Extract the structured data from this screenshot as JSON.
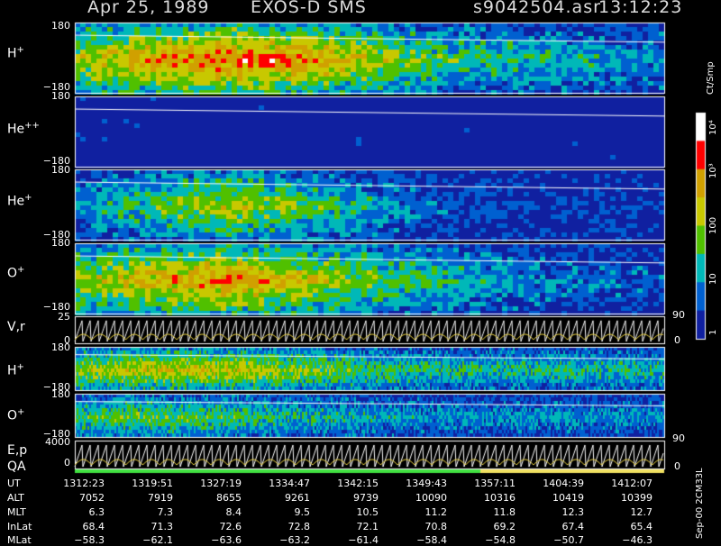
{
  "header": {
    "date": "Apr 25, 1989",
    "instrument": "EXOS-D SMS",
    "file": "s9042504.asr",
    "time": "13:12:23"
  },
  "panels": [
    {
      "label": "H",
      "sup": "+",
      "top_tick": "180",
      "bottom_tick": "−180"
    },
    {
      "label": "He",
      "sup": "++",
      "top_tick": "180",
      "bottom_tick": "−180"
    },
    {
      "label": "He",
      "sup": "+",
      "top_tick": "180",
      "bottom_tick": "−180"
    },
    {
      "label": "O",
      "sup": "+",
      "top_tick": "180",
      "bottom_tick": "−180"
    },
    {
      "label": "V,r",
      "sup": "",
      "top_tick": "25",
      "bottom_tick": "0",
      "right_top": "90",
      "right_bottom": "0"
    },
    {
      "label": "H",
      "sup": "+",
      "top_tick": "180",
      "bottom_tick": "−180"
    },
    {
      "label": "O",
      "sup": "+",
      "top_tick": "180",
      "bottom_tick": "−180"
    },
    {
      "label": "E,p",
      "sup": "",
      "top_tick": "4000",
      "bottom_tick": "0",
      "right_top": "90",
      "right_bottom": "0"
    }
  ],
  "qa_label": "QA",
  "colorbar": {
    "unit": "Ct/Smp",
    "labels": [
      "10⁴",
      "10³",
      "100",
      "10",
      "1"
    ],
    "colors": [
      "#ffffff",
      "#ff0000",
      "#d0a000",
      "#c8c800",
      "#50c000",
      "#00b8b8",
      "#0060d0",
      "#1020a0"
    ]
  },
  "footer_side": "Sep-00  2CM33L",
  "chart_data": {
    "type": "heatmap",
    "title": "Apr 25, 1989    EXOS-D SMS",
    "table": {
      "rows": [
        {
          "name": "UT",
          "values": [
            "1312:23",
            "1319:51",
            "1327:19",
            "1334:47",
            "1342:15",
            "1349:43",
            "1357:11",
            "1404:39",
            "1412:07"
          ]
        },
        {
          "name": "ALT",
          "values": [
            "7052",
            "7919",
            "8655",
            "9261",
            "9739",
            "10090",
            "10316",
            "10419",
            "10399"
          ]
        },
        {
          "name": "MLT",
          "values": [
            "6.3",
            "7.3",
            "8.4",
            "9.5",
            "10.5",
            "11.2",
            "11.8",
            "12.3",
            "12.7"
          ]
        },
        {
          "name": "InLat",
          "values": [
            "68.4",
            "71.3",
            "72.6",
            "72.8",
            "72.1",
            "70.8",
            "69.2",
            "67.4",
            "65.4"
          ]
        },
        {
          "name": "MLat",
          "values": [
            "−58.3",
            "−62.1",
            "−63.6",
            "−63.2",
            "−61.4",
            "−58.4",
            "−54.8",
            "−50.7",
            "−46.3"
          ]
        }
      ]
    },
    "heatmap_intensity": {
      "H+": [
        0.55,
        0.7,
        0.8,
        0.75,
        0.55,
        0.4,
        0.35,
        0.3,
        0.25
      ],
      "He++": [
        0.1,
        0.15,
        0.1,
        0.05,
        0.05,
        0.05,
        0.05,
        0.05,
        0.05
      ],
      "He+": [
        0.25,
        0.4,
        0.55,
        0.45,
        0.3,
        0.15,
        0.1,
        0.1,
        0.05
      ],
      "O+": [
        0.5,
        0.65,
        0.75,
        0.6,
        0.45,
        0.35,
        0.25,
        0.2,
        0.15
      ],
      "H+2": [
        0.5,
        0.6,
        0.6,
        0.5,
        0.4,
        0.35,
        0.35,
        0.35,
        0.35
      ],
      "O+2": [
        0.4,
        0.45,
        0.4,
        0.35,
        0.3,
        0.25,
        0.25,
        0.25,
        0.25
      ]
    }
  }
}
